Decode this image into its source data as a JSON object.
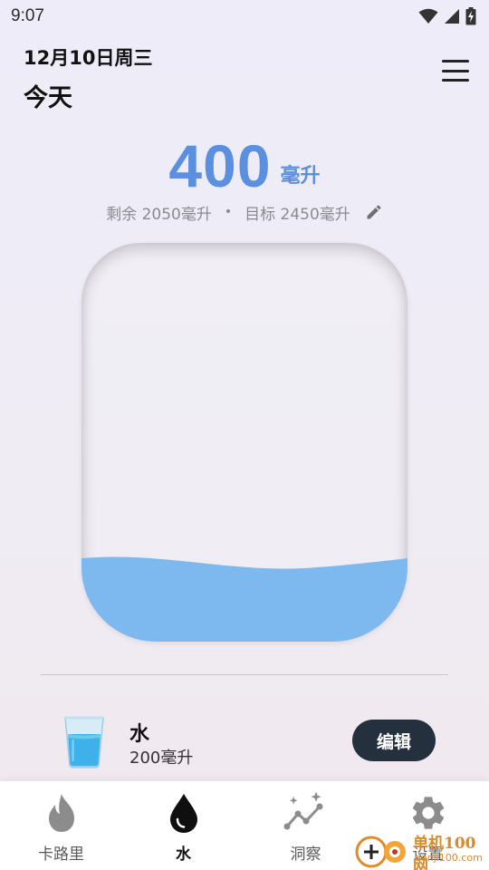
{
  "status_bar": {
    "time": "9:07",
    "icons": [
      "wifi-icon",
      "cellular-icon",
      "battery-charging-icon"
    ]
  },
  "header": {
    "date": "12月10日周三",
    "title": "今天",
    "menu_icon": "hamburger-menu-icon"
  },
  "intake": {
    "value": "400",
    "unit": "毫升",
    "remaining": "剩余 2050毫升",
    "separator": "•",
    "goal": "目标 2450毫升",
    "edit_icon": "pencil-icon",
    "fill_fraction": 0.2
  },
  "colors": {
    "accent": "#5b8fe0",
    "water": "#7db9ef",
    "button_dark": "#25303f"
  },
  "log": {
    "items": [
      {
        "icon": "water-glass-icon",
        "name": "水",
        "amount": "200毫升",
        "edit_label": "编辑"
      }
    ]
  },
  "bottom_nav": {
    "items": [
      {
        "icon": "flame-icon",
        "label": "卡路里",
        "active": false
      },
      {
        "icon": "water-drop-icon",
        "label": "水",
        "active": true
      },
      {
        "icon": "insights-icon",
        "label": "洞察",
        "active": false
      },
      {
        "icon": "gear-icon",
        "label": "设置",
        "active": false
      }
    ]
  },
  "watermark": {
    "text": "单机100网",
    "url": "danji100.com"
  }
}
